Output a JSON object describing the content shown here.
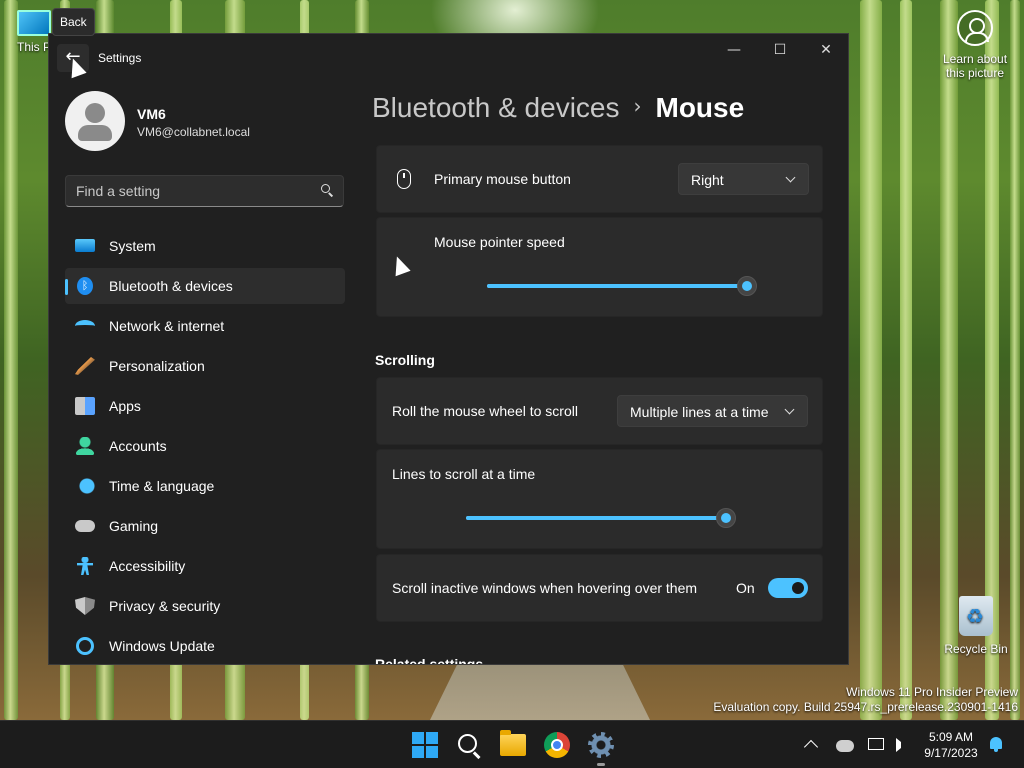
{
  "desktop": {
    "icons": {
      "this_pc": "This P",
      "learn_line1": "Learn about",
      "learn_line2": "this picture",
      "recycle_bin": "Recycle Bin"
    },
    "watermark": {
      "line1": "Windows 11 Pro Insider Preview",
      "line2": "Evaluation copy. Build 25947.rs_prerelease.230901-1416"
    }
  },
  "tooltip": {
    "text": "Back"
  },
  "window": {
    "title": "Settings",
    "back_glyph": "←",
    "controls": {
      "minimize": "—",
      "maximize": "☐",
      "close": "✕"
    }
  },
  "profile": {
    "name": "VM6",
    "email": "VM6@collabnet.local"
  },
  "search": {
    "placeholder": "Find a setting",
    "value": ""
  },
  "sidebar": {
    "items": [
      {
        "label": "System",
        "icon": "system-icon",
        "selected": false
      },
      {
        "label": "Bluetooth & devices",
        "icon": "bluetooth-icon",
        "selected": true
      },
      {
        "label": "Network & internet",
        "icon": "wifi-icon",
        "selected": false
      },
      {
        "label": "Personalization",
        "icon": "paintbrush-icon",
        "selected": false
      },
      {
        "label": "Apps",
        "icon": "apps-icon",
        "selected": false
      },
      {
        "label": "Accounts",
        "icon": "person-icon",
        "selected": false
      },
      {
        "label": "Time & language",
        "icon": "globe-clock-icon",
        "selected": false
      },
      {
        "label": "Gaming",
        "icon": "gamepad-icon",
        "selected": false
      },
      {
        "label": "Accessibility",
        "icon": "accessibility-icon",
        "selected": false
      },
      {
        "label": "Privacy & security",
        "icon": "shield-icon",
        "selected": false
      },
      {
        "label": "Windows Update",
        "icon": "update-icon",
        "selected": false
      }
    ]
  },
  "breadcrumb": {
    "parent": "Bluetooth & devices",
    "separator": "›",
    "current": "Mouse"
  },
  "main": {
    "primary_button": {
      "label": "Primary mouse button",
      "value": "Right"
    },
    "pointer_speed": {
      "label": "Mouse pointer speed",
      "level": 1.0
    },
    "scrolling_title": "Scrolling",
    "roll_wheel": {
      "label": "Roll the mouse wheel to scroll",
      "value": "Multiple lines at a time"
    },
    "lines_to_scroll": {
      "label": "Lines to scroll at a time",
      "level": 1.0
    },
    "scroll_inactive": {
      "label": "Scroll inactive windows when hovering over them",
      "state": "On",
      "on": true
    },
    "related_title": "Related settings"
  },
  "taskbar": {
    "apps": [
      "start-icon",
      "search-icon",
      "file-explorer-icon",
      "chrome-icon",
      "settings-gear-icon"
    ],
    "clock": {
      "time": "5:09 AM",
      "date": "9/17/2023"
    }
  },
  "colors": {
    "accent": "#4cc2ff",
    "window_bg": "#202020",
    "card_bg": "#2b2b2b"
  }
}
